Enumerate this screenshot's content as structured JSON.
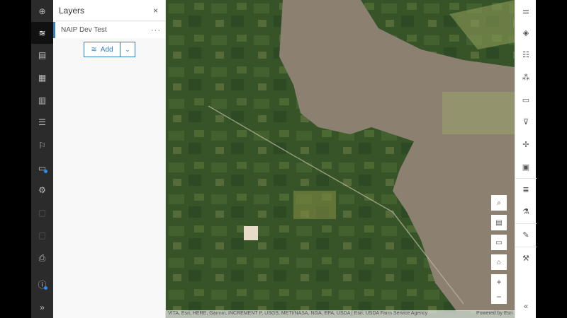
{
  "left_toolbar": [
    {
      "name": "add-icon",
      "glyph": "⊕"
    },
    {
      "name": "layers-icon",
      "glyph": "≋",
      "active": true
    },
    {
      "name": "table-icon",
      "glyph": "▤"
    },
    {
      "name": "basemap-icon",
      "glyph": "▦"
    },
    {
      "name": "charts-icon",
      "glyph": "▥"
    },
    {
      "name": "legend-icon",
      "glyph": "☰"
    },
    {
      "name": "bookmark-icon",
      "glyph": "⚐"
    },
    {
      "name": "folder-icon",
      "glyph": "▭",
      "dot": true
    },
    {
      "name": "settings-icon",
      "glyph": "⚙"
    },
    {
      "name": "save-icon",
      "glyph": "▢",
      "dim": true
    },
    {
      "name": "share-icon",
      "glyph": "▢",
      "dim": true
    },
    {
      "name": "print-icon",
      "glyph": "⎙"
    },
    {
      "name": "info-icon",
      "glyph": "ⓘ",
      "dot": true
    },
    {
      "name": "expand-icon",
      "glyph": "»"
    }
  ],
  "panel": {
    "title": "Layers",
    "close": "×",
    "layer_name": "NAIP Dev Test",
    "more": "···",
    "add_label": "Add",
    "add_dropdown": "⌄"
  },
  "map": {
    "attribution": "VITA, Esri, HERE, Garmin, INCREMENT P, USGS, METI/NASA, NGA, EPA, USDA | Esri, USDA Farm Service Agency",
    "powered": "Powered by Esri",
    "zoom_in": "+",
    "zoom_out": "−"
  },
  "right_toolbar": [
    {
      "name": "properties-icon",
      "glyph": "⚌"
    },
    {
      "name": "styles-icon",
      "glyph": "◈"
    },
    {
      "name": "fields-icon",
      "glyph": "☷"
    },
    {
      "name": "clustering-icon",
      "glyph": "⁂"
    },
    {
      "name": "popups-icon",
      "glyph": "▭"
    },
    {
      "name": "filter-icon",
      "glyph": "⊽"
    },
    {
      "name": "effects-icon",
      "glyph": "✢"
    },
    {
      "name": "labels-icon",
      "glyph": "▣"
    },
    {
      "name": "align-icon",
      "glyph": "≣"
    },
    {
      "name": "analysis-icon",
      "glyph": "⚗"
    },
    {
      "name": "sketch-icon",
      "glyph": "✎"
    },
    {
      "name": "tools-icon",
      "glyph": "⚒"
    },
    {
      "name": "collapse-icon",
      "glyph": "«"
    }
  ]
}
